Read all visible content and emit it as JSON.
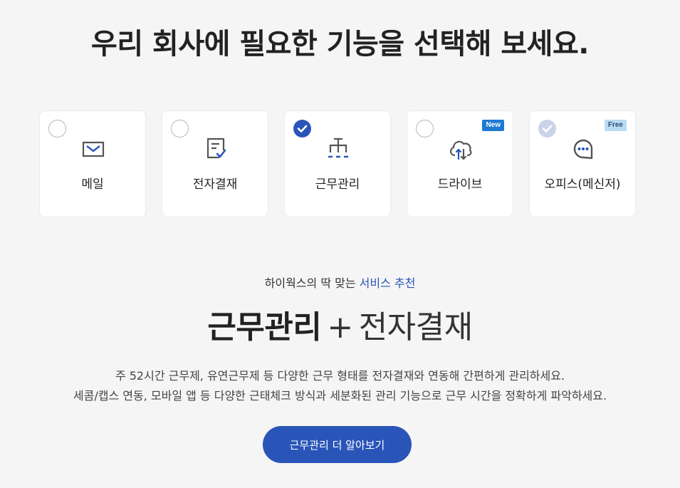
{
  "headline": "우리 회사에 필요한 기능을 선택해 보세요.",
  "features": [
    {
      "label": "메일",
      "icon": "mail-icon",
      "state": "unchecked",
      "badge": ""
    },
    {
      "label": "전자결재",
      "icon": "approval-document-icon",
      "state": "unchecked",
      "badge": ""
    },
    {
      "label": "근무관리",
      "icon": "org-chart-icon",
      "state": "checked",
      "badge": ""
    },
    {
      "label": "드라이브",
      "icon": "cloud-sync-icon",
      "state": "unchecked",
      "badge": "New"
    },
    {
      "label": "오피스(메신저)",
      "icon": "chat-bubble-icon",
      "state": "checked-disabled",
      "badge": "Free"
    }
  ],
  "recommendation": {
    "prefix": "하이웍스의 딱 맞는",
    "accent": "서비스 추천",
    "primary": "근무관리",
    "plus": "+",
    "secondary": "전자결재",
    "description_line1": "주 52시간 근무제, 유연근무제 등 다양한 근무 형태를 전자결재와 연동해 간편하게 관리하세요.",
    "description_line2": "세콤/캡스 연동, 모바일 앱 등 다양한 근태체크 방식과 세분화된 관리 기능으로 근무 시간을 정확하게 파악하세요.",
    "cta_label": "근무관리 더 알아보기"
  },
  "colors": {
    "accent": "#2a55b8",
    "background": "#f5f5f5",
    "badge_new": "#1f79d2",
    "badge_free": "#b9dbf4"
  }
}
